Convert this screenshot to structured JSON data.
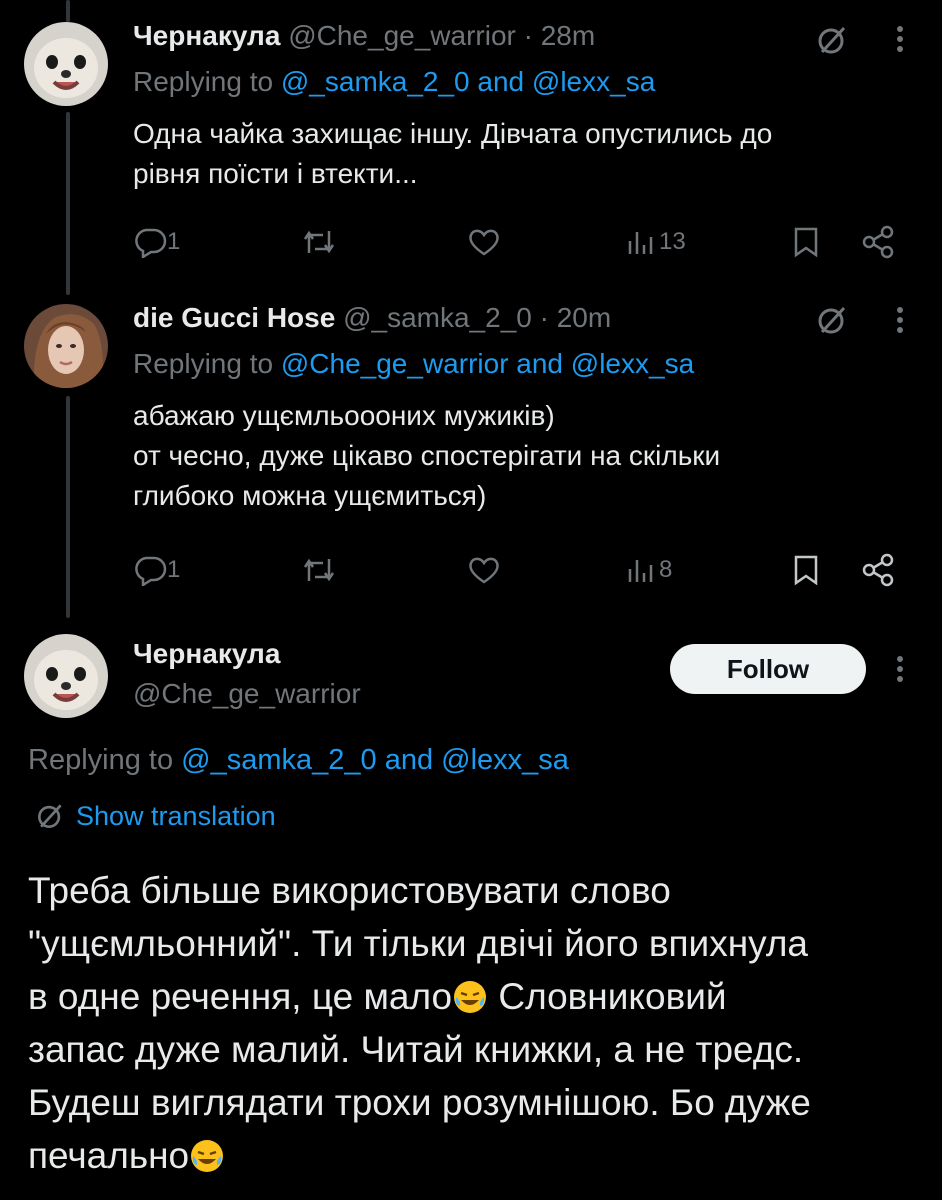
{
  "tweets": [
    {
      "author": "Чернакула",
      "handle": "@Che_ge_warrior",
      "time": "· 28m",
      "replying_prefix": "Replying to",
      "replying_users": "@_samka_2_0 and @lexx_sa",
      "text_lines": [
        "Одна чайка захищає іншу. Дівчата опустились до",
        "рівня поїсти і втекти..."
      ],
      "reply_count": "1",
      "retweet_count": "",
      "like_count": "",
      "view_count": "13"
    },
    {
      "author": "die Gucci Hose",
      "handle": "@_samka_2_0",
      "time": "· 20m",
      "replying_prefix": "Replying to",
      "replying_users": "@Che_ge_warrior and @lexx_sa",
      "text_lines": [
        "абажаю ущємльоооних мужиків)",
        "от чесно, дуже цікаво спостерігати на скільки",
        "глибоко можна ущємиться)"
      ],
      "reply_count": "1",
      "retweet_count": "",
      "like_count": "",
      "view_count": "8"
    }
  ],
  "main_tweet": {
    "author": "Чернакула",
    "handle": "@Che_ge_warrior",
    "follow_label": "Follow",
    "replying_prefix": "Replying to",
    "replying_users": "@_samka_2_0 and @lexx_sa",
    "translate_label": "Show translation",
    "text_lines": [
      "Треба більше використовувати слово",
      "\"ущємльонний\". Ти тільки двічі його впихнула",
      "в одне речення, це мало",
      "Словниковий",
      "запас дуже малий. Читай книжки, а не тредс.",
      "Будеш виглядати трохи розумнішою. Бо дуже",
      "печально"
    ]
  },
  "colors": {
    "background": "#000000",
    "text": "#e7e9ea",
    "muted": "#71767b",
    "link": "#1d9bf0",
    "follow_bg": "#eff3f4"
  },
  "icons": [
    "reply-icon",
    "retweet-icon",
    "like-icon",
    "views-icon",
    "bookmark-icon",
    "share-icon",
    "translate-icon",
    "more-icon",
    "laughing-emoji"
  ]
}
